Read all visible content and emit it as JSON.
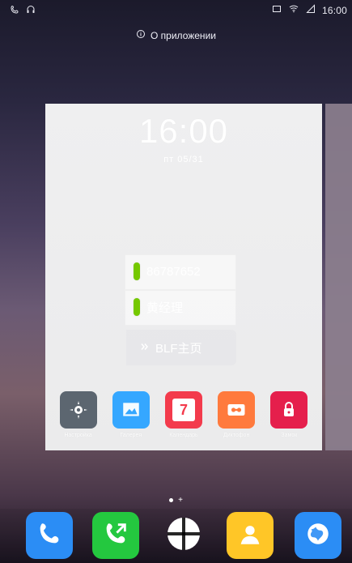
{
  "status_bar": {
    "time": "16:00",
    "left_icons": [
      "phone-call-icon",
      "headset-icon"
    ],
    "right_icons": [
      "screen-icon",
      "wifi-icon",
      "signal-icon"
    ]
  },
  "app_info": {
    "icon": "info-icon",
    "label": "О приложении"
  },
  "card": {
    "time": "16:00",
    "date": "пт   05/31",
    "lines": [
      {
        "label": "86787652",
        "status_color": "#75c800"
      },
      {
        "label": "黄经理",
        "status_color": "#75c800"
      }
    ],
    "blf_label": "BLF主页",
    "apps": [
      {
        "label": "Настройка",
        "icon": "gear-icon",
        "color": "#5c6670"
      },
      {
        "label": "Галерея",
        "icon": "gallery-icon",
        "color": "#35a7ff"
      },
      {
        "label": "Календарь",
        "icon": "calendar-icon",
        "color": "#f33b4c",
        "value": "7"
      },
      {
        "label": "Диктофон",
        "icon": "recorder-icon",
        "color": "#ff7a3d"
      },
      {
        "label": "Замок",
        "icon": "lock-icon",
        "color": "#e51f4c"
      }
    ]
  },
  "dock": {
    "items": [
      {
        "name": "phone",
        "icon": "phone-icon",
        "color": "#2b8df5"
      },
      {
        "name": "call",
        "icon": "call-icon",
        "color": "#24c83f"
      },
      {
        "name": "blf",
        "icon": "blf-icon",
        "color": "#ffffff"
      },
      {
        "name": "contacts",
        "icon": "contacts-icon",
        "color": "#ffc627"
      },
      {
        "name": "browser",
        "icon": "globe-icon",
        "color": "#2b8df5"
      }
    ]
  },
  "page_indicator": {
    "active": 1,
    "plus": "+"
  }
}
